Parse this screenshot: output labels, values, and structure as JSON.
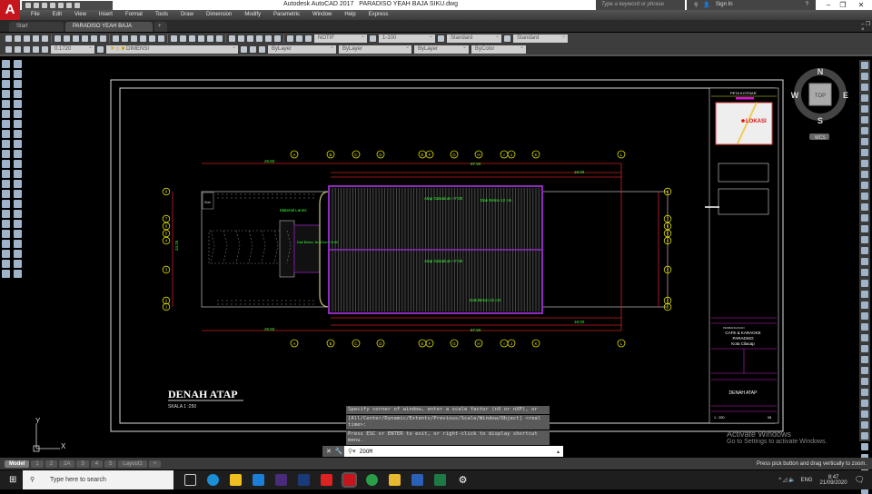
{
  "app": {
    "title": "Autodesk AutoCAD 2017",
    "file": "PARADISO YEAH BAJA SIKU.dwg",
    "logo": "A"
  },
  "search": {
    "placeholder": "Type a keyword or phrase"
  },
  "user": {
    "signin": "Sign In"
  },
  "menu": [
    "File",
    "Edit",
    "View",
    "Insert",
    "Format",
    "Tools",
    "Draw",
    "Dimension",
    "Modify",
    "Parametric",
    "Window",
    "Help",
    "Express"
  ],
  "tabs": {
    "start": "Start",
    "active": "PARADISO YEAH BAJA SIKU*",
    "add": "+"
  },
  "toolbar": {
    "text_style": "NOTIF",
    "dim_scale": "1-100",
    "table_style": "Standard",
    "mleader_style": "Standard",
    "lineweight_value": "0.1720",
    "layer": "DIMENSI",
    "color": "ByLayer",
    "linetype": "ByLayer",
    "lineweight": "ByLayer",
    "plotstyle": "ByColor"
  },
  "viewcube": {
    "n": "N",
    "s": "S",
    "e": "E",
    "w": "W",
    "top": "TOP",
    "wcs": "WCS"
  },
  "drawing": {
    "title": "DENAH ATAP",
    "scale": "SKALA 1 :250",
    "grid_top": [
      "A",
      "B",
      "C",
      "D",
      "E",
      "F",
      "G",
      "H",
      "I",
      "J",
      "K",
      "L"
    ],
    "grid_side": [
      "8",
      "7",
      "6",
      "5",
      "4",
      "3",
      "2",
      "1"
    ],
    "dims": {
      "total_left": "26.50",
      "total_right": "87.50",
      "right_end": "18.00",
      "height_total": "34.25"
    },
    "labels": {
      "roof_top": "Atap Galvalum +7.00",
      "roof_bottom": "Atap Galvalum +7.00",
      "gutter_top": "Dak Beton 12 cm",
      "gutter_bottom": "Dak Beton 12 cm",
      "material": "Material Lanes",
      "slab": "Dak Beton, tb=12cm +6.00",
      "stair": "Stair"
    }
  },
  "titleblock": {
    "map_title": "PETA KOTISAR",
    "map_label": "LOKASI",
    "project_header": "PEMBANGUNAN",
    "project": "CAFE & KARAOKE",
    "project2": "PARADISO",
    "city": "Kota Cilacap",
    "sheet_title": "DENAH ATAP",
    "scale": "1 : 250",
    "sheet_no": "08"
  },
  "command": {
    "history": [
      "Specify corner of window, enter a scale factor (nX or nXP), or",
      "[All/Center/Dynamic/Extents/Previous/Scale/Window/Object] <real time>:",
      "Press ESC or ENTER to exit, or right-click to display shortcut menu."
    ],
    "input": "ZOOM"
  },
  "layouts": [
    "Model",
    "1",
    "2",
    "2A",
    "3",
    "4",
    "5",
    "Layout1",
    "+"
  ],
  "status": {
    "message": "Press pick button and drag vertically to zoom."
  },
  "watermark": {
    "title": "Activate Windows",
    "subtitle": "Go to Settings to activate Windows."
  },
  "taskbar": {
    "search": "Type here to search",
    "lang": "ENG",
    "time": "8:47",
    "date": "21/09/2020"
  }
}
